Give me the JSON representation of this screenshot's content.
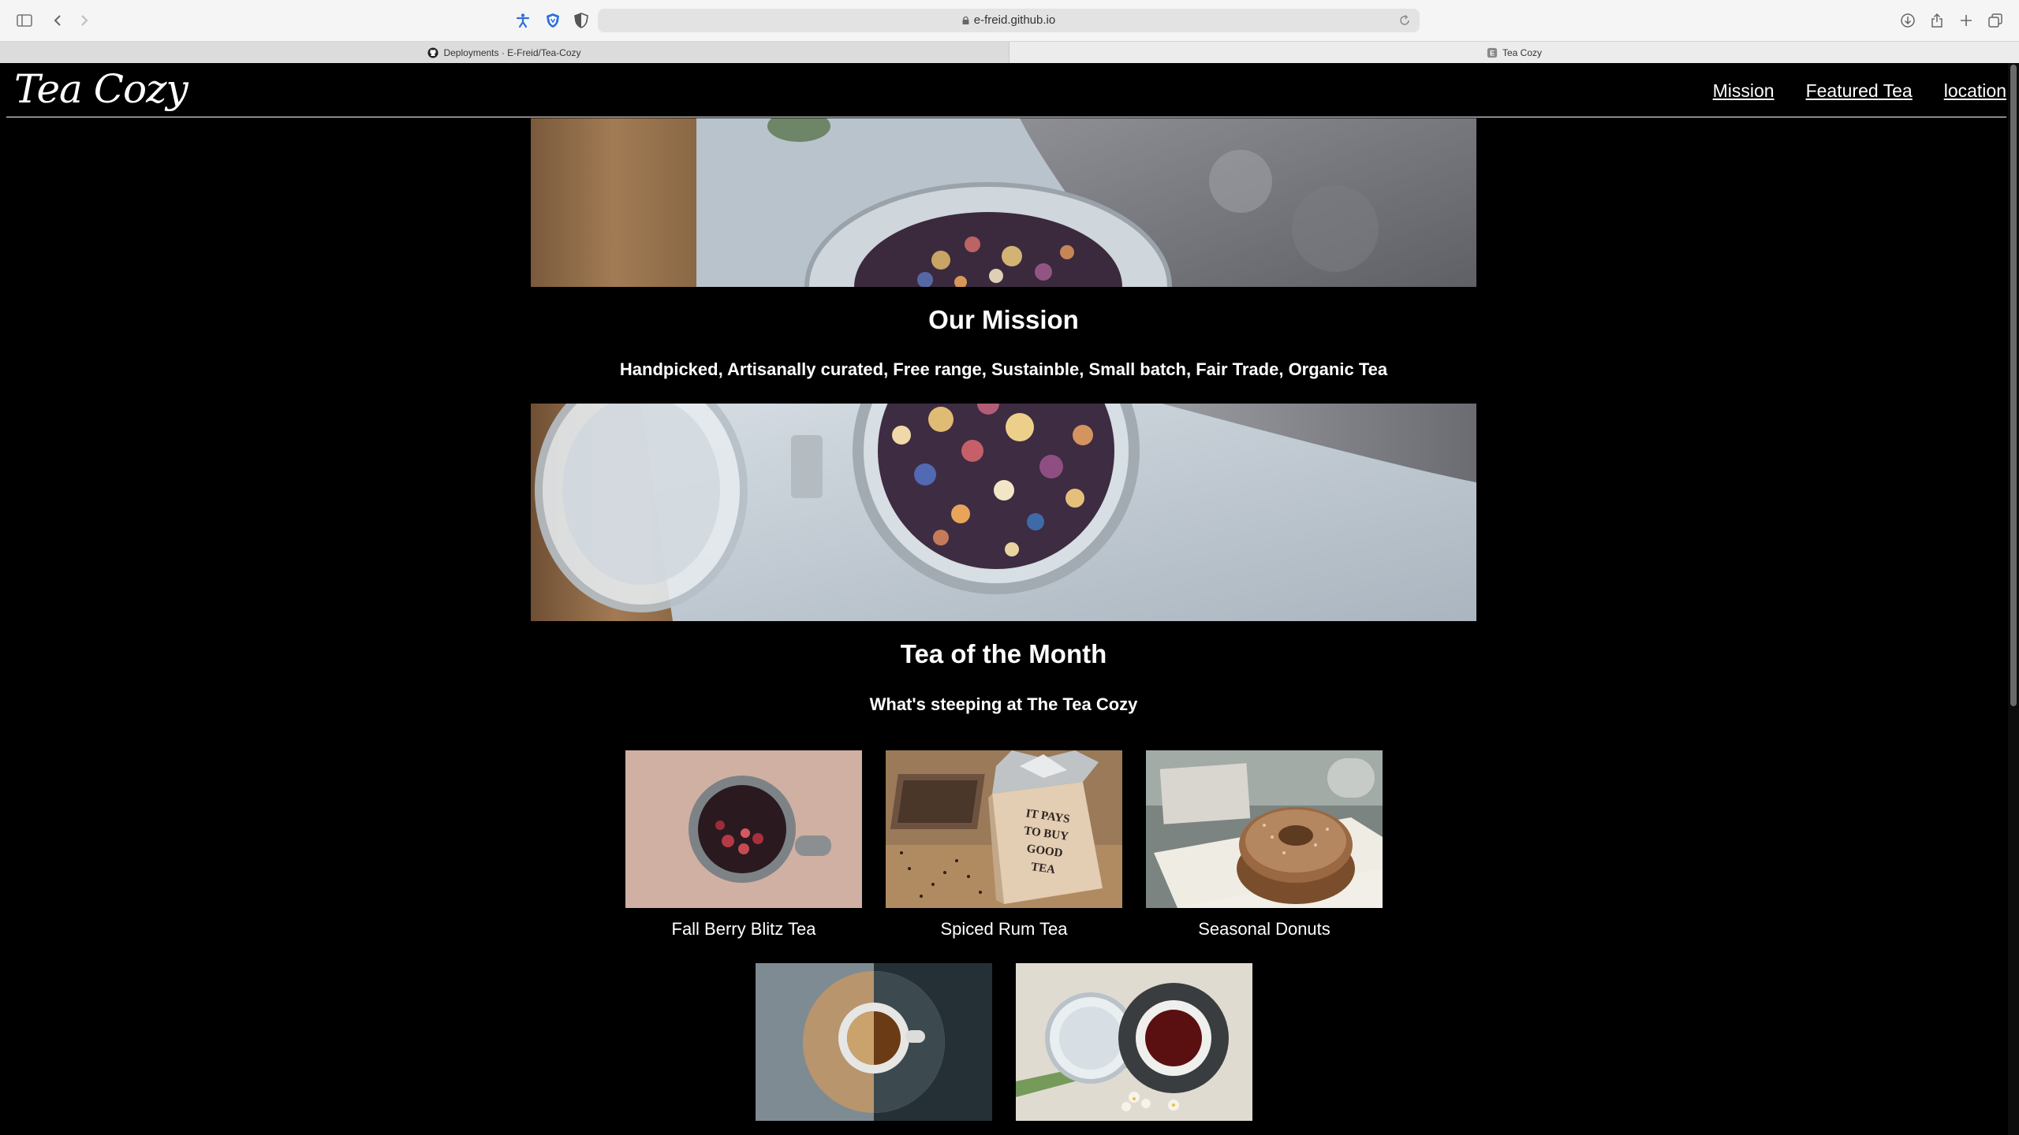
{
  "browser": {
    "url": "e-freid.github.io",
    "tabs": [
      {
        "title": "Deployments · E-Freid/Tea-Cozy",
        "active": false
      },
      {
        "title": "Tea Cozy",
        "active": true
      }
    ]
  },
  "site": {
    "logo": "Tea Cozy",
    "nav": [
      "Mission",
      "Featured Tea",
      "location"
    ]
  },
  "mission": {
    "title": "Our Mission",
    "subtitle": "Handpicked, Artisanally curated, Free range, Sustainble, Small batch, Fair Trade, Organic Tea"
  },
  "featured": {
    "title": "Tea of the Month",
    "subtitle": "What's steeping at The Tea Cozy",
    "items": [
      {
        "name": "Fall Berry Blitz Tea"
      },
      {
        "name": "Spiced Rum Tea"
      },
      {
        "name": "Seasonal Donuts"
      }
    ],
    "box_text": [
      "IT PAYS",
      "TO BUY",
      "GOOD",
      "TEA"
    ]
  },
  "colors": {
    "page_bg": "#000000",
    "text": "#ffffff"
  }
}
